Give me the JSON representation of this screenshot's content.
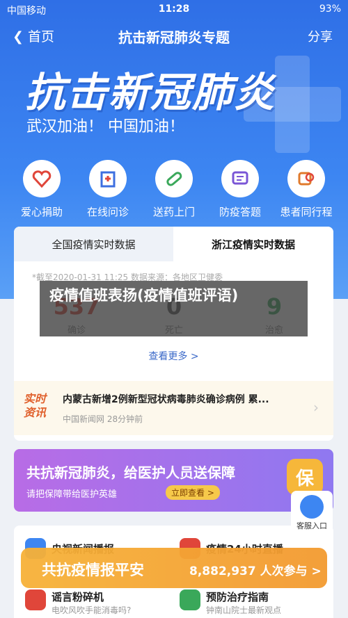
{
  "status_bar": {
    "carrier": "中国移动",
    "time": "11:28",
    "battery": "93%"
  },
  "nav": {
    "back_label": "首页",
    "title": "抗击新冠肺炎专题",
    "share_label": "分享"
  },
  "hero": {
    "title": "抗击新冠肺炎",
    "subtitle": "武汉加油！ 中国加油！"
  },
  "quick_icons": [
    {
      "label": "爱心捐助",
      "icon": "heart-icon"
    },
    {
      "label": "在线问诊",
      "icon": "clinic-icon"
    },
    {
      "label": "送药上门",
      "icon": "pill-icon"
    },
    {
      "label": "防疫答题",
      "icon": "quiz-icon"
    },
    {
      "label": "患者同行程",
      "icon": "search-train-icon"
    }
  ],
  "data_card": {
    "tabs": [
      "全国疫情实时数据",
      "浙江疫情实时数据"
    ],
    "note": "*截至2020-01-31 11:25 数据来源：各地区卫健委",
    "stats": [
      {
        "value": "537",
        "label": "确诊",
        "color": "#e0463a"
      },
      {
        "value": "0",
        "label": "死亡",
        "color": "#555555"
      },
      {
        "value": "9",
        "label": "治愈",
        "color": "#3aa85a"
      }
    ],
    "more": "查看更多 >"
  },
  "news": {
    "badge_line1": "实时",
    "badge_line2": "资讯",
    "title": "内蒙古新增2例新型冠状病毒肺炎确诊病例 累...",
    "source": "中国新闻网 28分钟前"
  },
  "banner": {
    "title": "共抗新冠肺炎，给医护人员送保障",
    "subtitle": "请把保障带给医护英雄",
    "button": "立即查看 >",
    "badge": "保"
  },
  "service": {
    "label": "客服入口"
  },
  "list": [
    {
      "title": "央视新闻播报",
      "sub": ""
    },
    {
      "title": "疫情24小时直播",
      "sub": ""
    },
    {
      "title": "谣言粉碎机",
      "sub": "电吹风吹手能消毒吗?"
    },
    {
      "title": "预防治疗指南",
      "sub": "钟南山院士最新观点"
    }
  ],
  "float_bar": {
    "title": "共抗疫情报平安",
    "count": "8,882,937 人次参与 >"
  },
  "overlay": {
    "text": "疫情值班表扬(疫情值班评语)"
  },
  "colors": {
    "primary_blue": "#3d86f2",
    "orange": "#f39a30",
    "purple": "#9b74ee"
  }
}
